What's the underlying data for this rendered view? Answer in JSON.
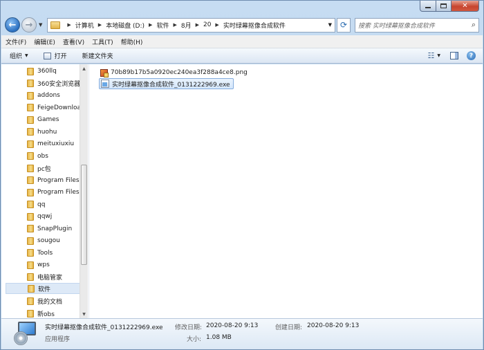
{
  "window": {
    "caption": {
      "min": "—",
      "max": "□",
      "close": "✕"
    }
  },
  "address_bar": {
    "crumbs": [
      "计算机",
      "本地磁盘 (D:)",
      "软件",
      "8月",
      "20",
      "实时绿幕抠像合成软件"
    ],
    "search_placeholder": "搜索 实时绿幕抠像合成软件"
  },
  "menubar": {
    "items": [
      "文件(F)",
      "编辑(E)",
      "查看(V)",
      "工具(T)",
      "帮助(H)"
    ]
  },
  "toolbar": {
    "organize": "组织",
    "open": "打开",
    "new_folder": "新建文件夹"
  },
  "nav_pane": {
    "items": [
      "360llq",
      "360安全浏览器",
      "addons",
      "FeigeDownload",
      "Games",
      "huohu",
      "meituxiuxiu",
      "obs",
      "pc包",
      "Program Files",
      "Program Files",
      "qq",
      "qqwj",
      "SnapPlugin",
      "sougou",
      "Tools",
      "wps",
      "电脑管家",
      "软件",
      "我的文档",
      "新obs"
    ],
    "selected": "软件"
  },
  "files": [
    {
      "name": "70b89b17b5a0920ec240ea3f288a4ce8.png",
      "type": "png",
      "selected": false
    },
    {
      "name": "实时绿幕抠像合成软件_0131222969.exe",
      "type": "exe",
      "selected": true
    }
  ],
  "details": {
    "filename": "实时绿幕抠像合成软件_0131222969.exe",
    "type": "应用程序",
    "modified_label": "修改日期:",
    "modified_value": "2020-08-20 9:13",
    "created_label": "创建日期:",
    "created_value": "2020-08-20 9:13",
    "size_label": "大小:",
    "size_value": "1.08 MB"
  },
  "icons": {
    "back": "arrow-left-icon",
    "forward": "arrow-right-icon",
    "refresh": "refresh-icon",
    "search": "search-icon",
    "help": "help-icon"
  }
}
